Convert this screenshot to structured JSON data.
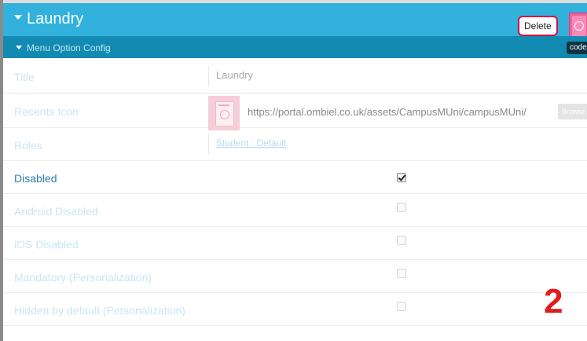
{
  "header": {
    "title": "Laundry",
    "delete_label": "Delete",
    "color": "#31b1dc"
  },
  "subheader": {
    "title": "Menu Option Config",
    "code_label": "code",
    "color": "#138ab2"
  },
  "fields": {
    "title": {
      "label": "Title",
      "value": "Laundry"
    },
    "recents_icon": {
      "label": "Recents Icon",
      "url": "https://portal.ombiel.co.uk/assets/CampusMUni/campusMUni/",
      "browse_label": "Browse"
    },
    "roles": {
      "label": "Roles",
      "value": "Student : Default"
    },
    "disabled": {
      "label": "Disabled",
      "checked": true
    },
    "android_disabled": {
      "label": "Android Disabled",
      "checked": false
    },
    "ios_disabled": {
      "label": "iOS Disabled",
      "checked": false
    },
    "mandatory": {
      "label": "Mandatory (Personalization)",
      "checked": false
    },
    "hidden_by_default": {
      "label": "Hidden by default (Personalization)",
      "checked": false
    }
  },
  "annotation": {
    "number": "2",
    "color": "#e01e1e"
  }
}
